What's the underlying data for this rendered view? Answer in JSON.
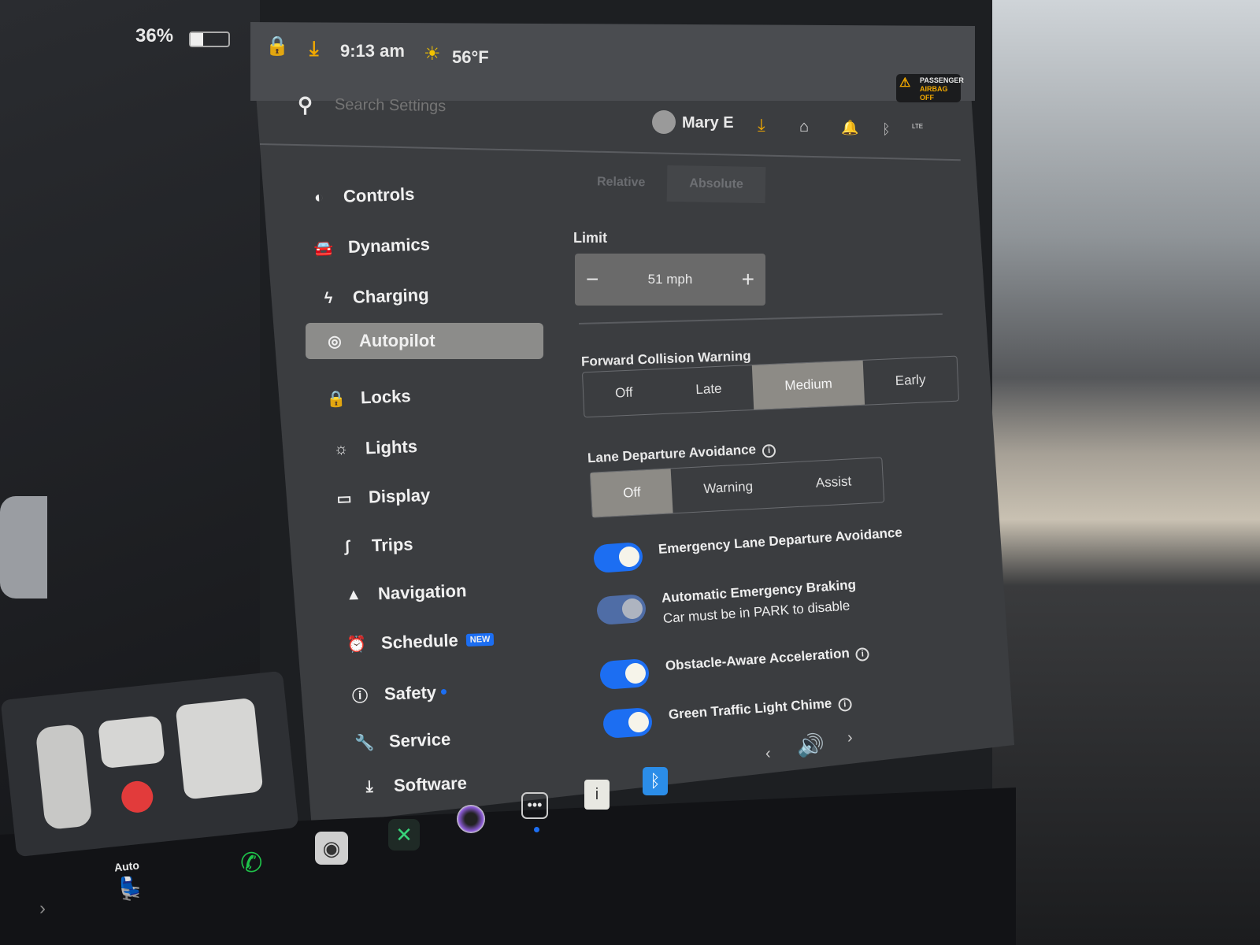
{
  "status_bar": {
    "battery": "36%",
    "time": "9:13 am",
    "temperature": "56°F",
    "airbag_line1": "PASSENGER",
    "airbag_line2": "AIRBAG OFF"
  },
  "header": {
    "search_placeholder": "Search Settings",
    "user_name": "Mary E",
    "network": "LTE"
  },
  "sidebar": {
    "items": [
      {
        "label": "Controls",
        "icon": "toggle-icon"
      },
      {
        "label": "Dynamics",
        "icon": "car-icon"
      },
      {
        "label": "Charging",
        "icon": "bolt-icon"
      },
      {
        "label": "Autopilot",
        "icon": "steering-wheel-icon",
        "active": true
      },
      {
        "label": "Locks",
        "icon": "lock-icon"
      },
      {
        "label": "Lights",
        "icon": "sun-icon"
      },
      {
        "label": "Display",
        "icon": "display-icon"
      },
      {
        "label": "Trips",
        "icon": "trips-icon"
      },
      {
        "label": "Navigation",
        "icon": "navigation-icon"
      },
      {
        "label": "Schedule",
        "icon": "alarm-icon",
        "badge": "NEW"
      },
      {
        "label": "Safety",
        "icon": "safety-icon"
      },
      {
        "label": "Service",
        "icon": "wrench-icon"
      },
      {
        "label": "Software",
        "icon": "download-icon"
      }
    ]
  },
  "main": {
    "offset_tabs": [
      "Relative",
      "Absolute"
    ],
    "offset_selected": "Absolute",
    "limit_label": "Limit",
    "limit_value": "51 mph",
    "fcw_label": "Forward Collision Warning",
    "fcw_options": [
      "Off",
      "Late",
      "Medium",
      "Early"
    ],
    "fcw_selected": "Medium",
    "lda_label": "Lane Departure Avoidance",
    "lda_options": [
      "Off",
      "Warning",
      "Assist"
    ],
    "lda_selected": "Off",
    "toggles": [
      {
        "label": "Emergency Lane Departure Avoidance",
        "on": true
      },
      {
        "label": "Automatic Emergency Braking",
        "sub": "Car must be in PARK to disable",
        "on": true,
        "disabled": true
      },
      {
        "label": "Obstacle-Aware Acceleration",
        "on": true,
        "info": true
      },
      {
        "label": "Green Traffic Light Chime",
        "on": true,
        "info": true
      }
    ]
  },
  "taskbar": {
    "seat_heat_label": "Auto",
    "accent": "#1c6ef2",
    "download_color": "#f2a900"
  }
}
